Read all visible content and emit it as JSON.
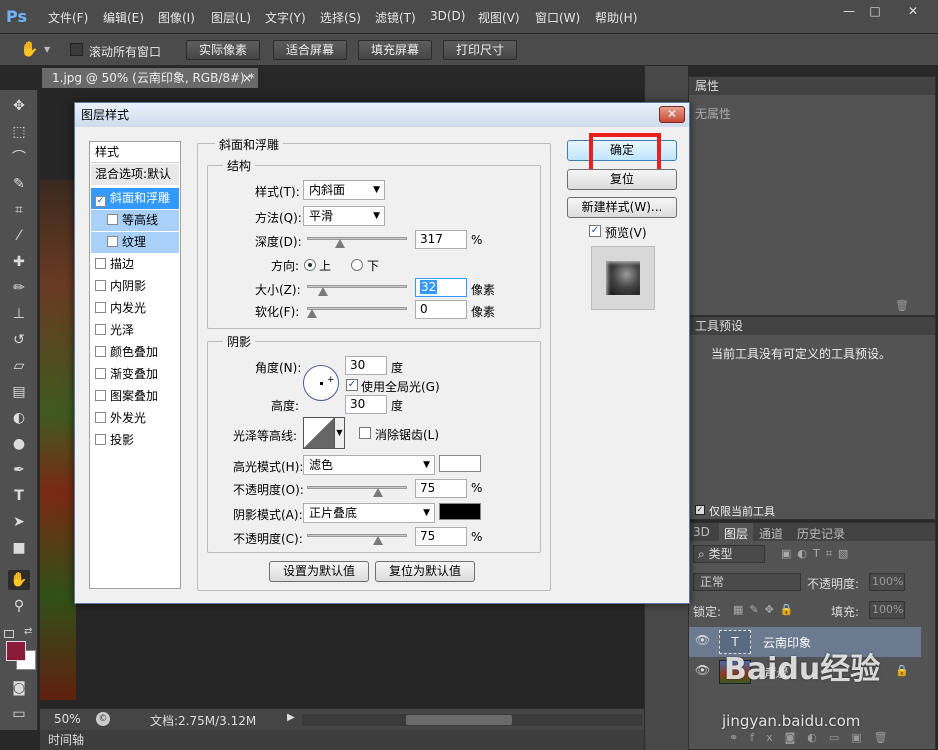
{
  "menubar": {
    "logo": "Ps",
    "items": [
      "文件(F)",
      "编辑(E)",
      "图像(I)",
      "图层(L)",
      "文字(Y)",
      "选择(S)",
      "滤镜(T)",
      "3D(D)",
      "视图(V)",
      "窗口(W)",
      "帮助(H)"
    ]
  },
  "options_bar": {
    "scroll_all_label": "滚动所有窗口",
    "buttons": [
      "实际像素",
      "适合屏幕",
      "填充屏幕",
      "打印尺寸"
    ]
  },
  "document": {
    "tab_title": "1.jpg @ 50% (云南印象, RGB/8#) *",
    "tab_close": "×",
    "zoom": "50%",
    "doc_size": "文档:2.75M/3.12M"
  },
  "timeline_label": "时间轴",
  "properties_panel": {
    "tab": "属性",
    "text": "无属性"
  },
  "tool_presets_panel": {
    "tab": "工具预设",
    "message": "当前工具没有可定义的工具预设。",
    "current_tool_only": "仅限当前工具"
  },
  "layers_panel": {
    "tabs": [
      "3D",
      "图层",
      "通道",
      "历史记录"
    ],
    "filter_label": "类型",
    "blend_mode": "正常",
    "opacity_label": "不透明度:",
    "opacity_value": "100%",
    "lock_label": "锁定:",
    "fill_label": "填充:",
    "fill_value": "100%",
    "layers": [
      {
        "name": "云南印象",
        "thumb": "T"
      },
      {
        "name": "背景"
      }
    ]
  },
  "dialog": {
    "title": "图层样式",
    "style_list": {
      "header": "样式",
      "blend_options": "混合选项:默认",
      "items": [
        {
          "label": "斜面和浮雕",
          "checked": true
        },
        {
          "label": "等高线",
          "checked": false
        },
        {
          "label": "纹理",
          "checked": false
        },
        {
          "label": "描边",
          "checked": false
        },
        {
          "label": "内阴影",
          "checked": false
        },
        {
          "label": "内发光",
          "checked": false
        },
        {
          "label": "光泽",
          "checked": false
        },
        {
          "label": "颜色叠加",
          "checked": false
        },
        {
          "label": "渐变叠加",
          "checked": false
        },
        {
          "label": "图案叠加",
          "checked": false
        },
        {
          "label": "外发光",
          "checked": false
        },
        {
          "label": "投影",
          "checked": false
        }
      ]
    },
    "bevel": {
      "section_title": "斜面和浮雕",
      "structure_title": "结构",
      "style_label": "样式(T):",
      "style_value": "内斜面",
      "technique_label": "方法(Q):",
      "technique_value": "平滑",
      "depth_label": "深度(D):",
      "depth_value": "317",
      "depth_unit": "%",
      "depth_fraction": 0.317,
      "direction_label": "方向:",
      "dir_up": "上",
      "dir_down": "下",
      "size_label": "大小(Z):",
      "size_value": "32",
      "size_unit": "像素",
      "size_fraction": 0.13,
      "soften_label": "软化(F):",
      "soften_value": "0",
      "soften_unit": "像素",
      "soften_fraction": 0
    },
    "shading": {
      "title": "阴影",
      "angle_label": "角度(N):",
      "angle_value": "30",
      "angle_unit": "度",
      "global_light_label": "使用全局光(G)",
      "altitude_label": "高度:",
      "altitude_value": "30",
      "altitude_unit": "度",
      "gloss_contour_label": "光泽等高线:",
      "anti_alias_label": "消除锯齿(L)",
      "highlight_mode_label": "高光模式(H):",
      "highlight_mode_value": "滤色",
      "highlight_color": "#ffffff",
      "highlight_opacity_label": "不透明度(O):",
      "highlight_opacity_value": "75",
      "highlight_opacity_unit": "%",
      "highlight_opacity_fraction": 0.75,
      "shadow_mode_label": "阴影模式(A):",
      "shadow_mode_value": "正片叠底",
      "shadow_color": "#000000",
      "shadow_opacity_label": "不透明度(C):",
      "shadow_opacity_value": "75",
      "shadow_opacity_unit": "%",
      "shadow_opacity_fraction": 0.75
    },
    "make_default": "设置为默认值",
    "reset_default": "复位为默认值",
    "ok_button": "确定",
    "reset_button": "复位",
    "new_style_button": "新建样式(W)...",
    "preview_label": "预览(V)"
  },
  "watermark": {
    "brand": "Baidu经验",
    "url": "jingyan.baidu.com"
  },
  "colors": {
    "highlight_box": "#e82020",
    "foreground": "#8a1a3a",
    "selection": "#3399ff"
  }
}
